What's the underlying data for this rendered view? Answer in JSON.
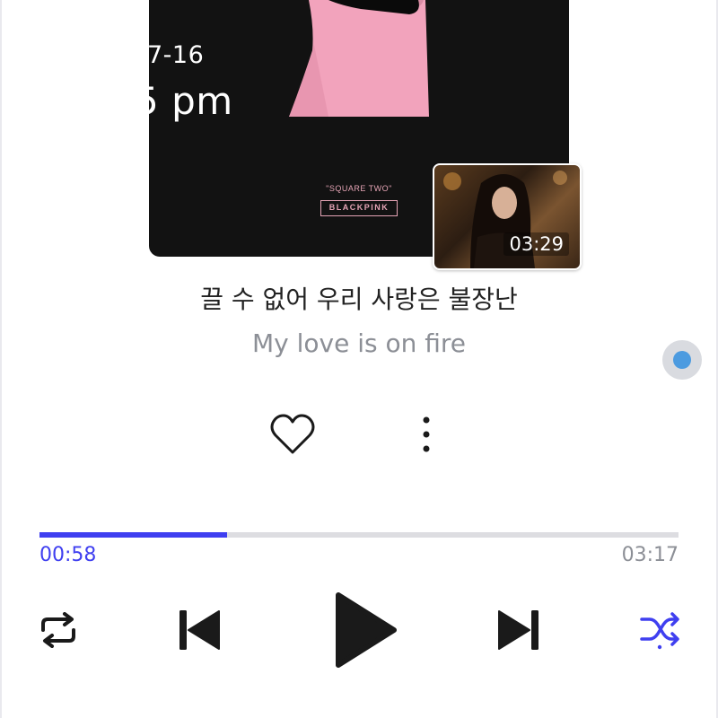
{
  "overlay": {
    "date_fragment": "7-16",
    "time_fragment": "5 pm"
  },
  "album": {
    "subtitle": "\"SQUARE TWO\"",
    "artist_logo": "BLACKPINK",
    "colors": {
      "background": "#121212",
      "pink": "#f2a3bc"
    }
  },
  "video_preview": {
    "duration": "03:29"
  },
  "lyrics": {
    "korean": "끌 수 없어 우리 사랑은 불장난",
    "english": "My love is on fire"
  },
  "actions": {
    "like_icon": "heart-outline-icon",
    "more_icon": "more-vertical-icon"
  },
  "playback": {
    "elapsed": "00:58",
    "total": "03:17",
    "progress_fraction": 0.294
  },
  "controls": {
    "repeat_icon": "repeat-icon",
    "previous_icon": "skip-previous-icon",
    "play_icon": "play-icon",
    "next_icon": "skip-next-icon",
    "shuffle_icon": "shuffle-icon"
  },
  "colors": {
    "accent": "#3f3ff0",
    "muted_text": "#8c8f96",
    "track": "#dddde1",
    "floating_button": "#4c9be0"
  }
}
